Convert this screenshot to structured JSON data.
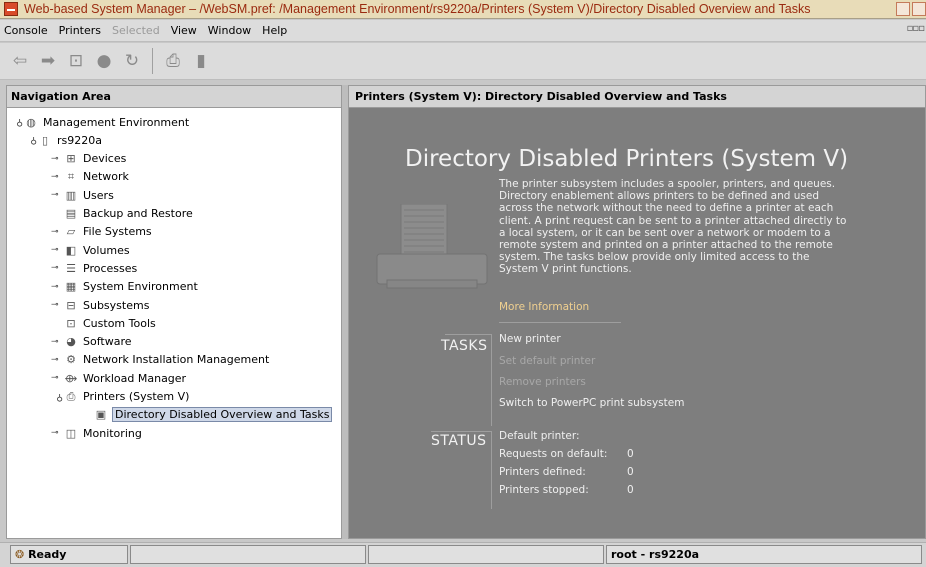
{
  "window": {
    "title": "Web-based System Manager – /WebSM.pref: /Management Environment/rs9220a/Printers (System V)/Directory Disabled Overview and Tasks"
  },
  "menubar": {
    "items": [
      {
        "label": "Console",
        "enabled": true
      },
      {
        "label": "Printers",
        "enabled": true
      },
      {
        "label": "Selected",
        "enabled": false
      },
      {
        "label": "View",
        "enabled": true
      },
      {
        "label": "Window",
        "enabled": true
      },
      {
        "label": "Help",
        "enabled": true
      }
    ]
  },
  "toolbar": {
    "buttons": [
      "back-icon",
      "forward-icon",
      "up-icon",
      "stop-icon",
      "reload-icon",
      "print-icon",
      "delete-icon"
    ]
  },
  "nav": {
    "header": "Navigation Area",
    "tree": [
      {
        "label": "Management Environment",
        "icon": "globe-icon",
        "toggle": "expanded"
      },
      {
        "label": "rs9220a",
        "icon": "computer-icon",
        "toggle": "expanded"
      },
      {
        "label": "Devices",
        "icon": "devices-icon",
        "toggle": "collapsed"
      },
      {
        "label": "Network",
        "icon": "network-icon",
        "toggle": "collapsed"
      },
      {
        "label": "Users",
        "icon": "users-icon",
        "toggle": "collapsed"
      },
      {
        "label": "Backup and Restore",
        "icon": "backup-icon",
        "toggle": "none"
      },
      {
        "label": "File Systems",
        "icon": "folder-icon",
        "toggle": "collapsed"
      },
      {
        "label": "Volumes",
        "icon": "volumes-icon",
        "toggle": "collapsed"
      },
      {
        "label": "Processes",
        "icon": "processes-icon",
        "toggle": "collapsed"
      },
      {
        "label": "System Environment",
        "icon": "system-environment-icon",
        "toggle": "collapsed"
      },
      {
        "label": "Subsystems",
        "icon": "subsystems-icon",
        "toggle": "collapsed"
      },
      {
        "label": "Custom Tools",
        "icon": "tools-icon",
        "toggle": "none"
      },
      {
        "label": "Software",
        "icon": "software-icon",
        "toggle": "collapsed"
      },
      {
        "label": "Network Installation Management",
        "icon": "nim-icon",
        "toggle": "collapsed"
      },
      {
        "label": "Workload Manager",
        "icon": "workload-icon",
        "toggle": "collapsed"
      },
      {
        "label": "Printers (System V)",
        "icon": "printer-icon",
        "toggle": "expanded"
      },
      {
        "label": "Directory Disabled Overview and Tasks",
        "icon": "overview-icon",
        "toggle": "none",
        "selected": true
      },
      {
        "label": "Monitoring",
        "icon": "monitor-icon",
        "toggle": "collapsed"
      }
    ]
  },
  "content": {
    "header": "Printers (System V): Directory Disabled Overview and Tasks",
    "title": "Directory Disabled Printers (System V)",
    "description": "The printer subsystem includes a spooler, printers, and queues.  Directory enablement allows printers to be defined and used across the network without the need to define a printer at each client.  A print request can be sent to a printer attached directly to a local system, or it can be sent over a network or modem to a remote system and printed on a printer attached to the remote system.  The tasks below provide only limited access to the System V print functions.",
    "more_info": "More Information",
    "tasks_label": "TASKS",
    "tasks": [
      {
        "label": "New printer",
        "enabled": true
      },
      {
        "label": "Set default printer",
        "enabled": false
      },
      {
        "label": "Remove printers",
        "enabled": false
      },
      {
        "label": "Switch to PowerPC print subsystem",
        "enabled": true
      }
    ],
    "status_label": "STATUS",
    "status": [
      {
        "label": "Default printer:",
        "value": ""
      },
      {
        "label": "Requests on default:",
        "value": "0"
      },
      {
        "label": "Printers defined:",
        "value": "0"
      },
      {
        "label": "Printers stopped:",
        "value": "0"
      }
    ]
  },
  "statusbar": {
    "state": "Ready",
    "user": "root - rs9220a"
  }
}
